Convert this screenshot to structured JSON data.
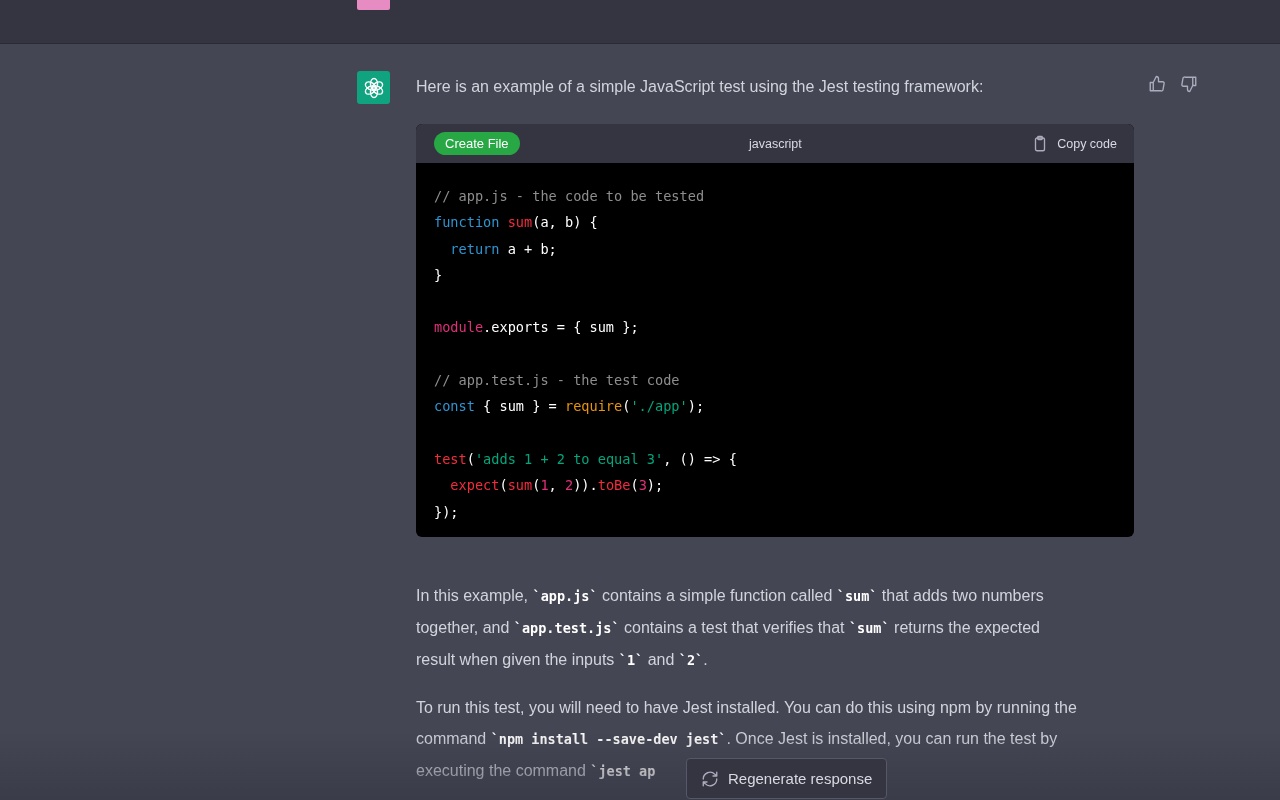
{
  "message": {
    "text": "Here is an example of a simple JavaScript test using the Jest testing framework:",
    "code_block": {
      "action": "Create File",
      "language": "javascript",
      "copy": "Copy code",
      "lines": [
        {
          "kind": "code",
          "tokens": [
            {
              "kind": "comment",
              "text": "// app.js - the code to be tested"
            }
          ]
        },
        {
          "kind": "code",
          "tokens": [
            {
              "kind": "keyword",
              "text": "function "
            },
            {
              "kind": "func",
              "text": "sum"
            },
            {
              "kind": "plain",
              "text": "(a, b) {"
            }
          ]
        },
        {
          "kind": "code",
          "indent": true,
          "tokens": [
            {
              "kind": "keyword",
              "text": "return"
            },
            {
              "kind": "plain",
              "text": " a + b;"
            }
          ]
        },
        {
          "kind": "code",
          "tokens": [
            {
              "kind": "plain",
              "text": "}"
            }
          ]
        },
        {
          "kind": "blank"
        },
        {
          "kind": "code",
          "tokens": [
            {
              "kind": "module",
              "text": "module"
            },
            {
              "kind": "plain",
              "text": ".exports = { sum };"
            }
          ]
        },
        {
          "kind": "blank"
        },
        {
          "kind": "code",
          "tokens": [
            {
              "kind": "comment",
              "text": "// app.test.js - the test code"
            }
          ]
        },
        {
          "kind": "code",
          "tokens": [
            {
              "kind": "keyword",
              "text": "const"
            },
            {
              "kind": "plain",
              "text": " { sum } = "
            },
            {
              "kind": "builtin",
              "text": "require"
            },
            {
              "kind": "plain",
              "text": "("
            },
            {
              "kind": "string",
              "text": "'./app'"
            },
            {
              "kind": "plain",
              "text": ");"
            }
          ]
        },
        {
          "kind": "blank"
        },
        {
          "kind": "code",
          "tokens": [
            {
              "kind": "func",
              "text": "test"
            },
            {
              "kind": "plain",
              "text": "("
            },
            {
              "kind": "string",
              "text": "'adds 1 + 2 to equal 3'"
            },
            {
              "kind": "plain",
              "text": ", () => {"
            }
          ]
        },
        {
          "kind": "code",
          "indent": true,
          "tokens": [
            {
              "kind": "func",
              "text": "expect"
            },
            {
              "kind": "plain",
              "text": "("
            },
            {
              "kind": "func",
              "text": "sum"
            },
            {
              "kind": "plain",
              "text": "("
            },
            {
              "kind": "number",
              "text": "1"
            },
            {
              "kind": "plain",
              "text": ", "
            },
            {
              "kind": "number",
              "text": "2"
            },
            {
              "kind": "plain",
              "text": "))."
            },
            {
              "kind": "func",
              "text": "toBe"
            },
            {
              "kind": "plain",
              "text": "("
            },
            {
              "kind": "number",
              "text": "3"
            },
            {
              "kind": "plain",
              "text": ");"
            }
          ]
        },
        {
          "kind": "code",
          "tokens": [
            {
              "kind": "plain",
              "text": "});"
            }
          ]
        }
      ]
    },
    "paragraphs": [
      {
        "lines": [
          [
            {
              "kind": "text",
              "text": "In this example, "
            },
            {
              "kind": "code",
              "text": "`app.js`"
            },
            {
              "kind": "text",
              "text": " contains a simple function called "
            },
            {
              "kind": "code",
              "text": "`sum`"
            },
            {
              "kind": "text",
              "text": " that adds two numbers"
            }
          ],
          [
            {
              "kind": "text",
              "text": "together, and "
            },
            {
              "kind": "code",
              "text": "`app.test.js`"
            },
            {
              "kind": "text",
              "text": " contains a test that verifies that "
            },
            {
              "kind": "code",
              "text": "`sum`"
            },
            {
              "kind": "text",
              "text": " returns the expected"
            }
          ],
          [
            {
              "kind": "text",
              "text": "result when given the inputs "
            },
            {
              "kind": "code",
              "text": "`1`"
            },
            {
              "kind": "text",
              "text": " and "
            },
            {
              "kind": "code",
              "text": "`2`"
            },
            {
              "kind": "text",
              "text": "."
            }
          ]
        ]
      },
      {
        "lines": [
          [
            {
              "kind": "text",
              "text": "To run this test, you will need to have Jest installed. You can do this using npm by running the"
            }
          ],
          [
            {
              "kind": "text",
              "text": "command "
            },
            {
              "kind": "code",
              "text": "`npm install --save-dev jest`"
            },
            {
              "kind": "text",
              "text": ". Once Jest is installed, you can run the test by"
            }
          ],
          [
            {
              "kind": "text",
              "text": "executing the command "
            },
            {
              "kind": "code",
              "text": "`jest ap"
            }
          ]
        ]
      }
    ]
  },
  "regenerate_button": "Regenerate response"
}
